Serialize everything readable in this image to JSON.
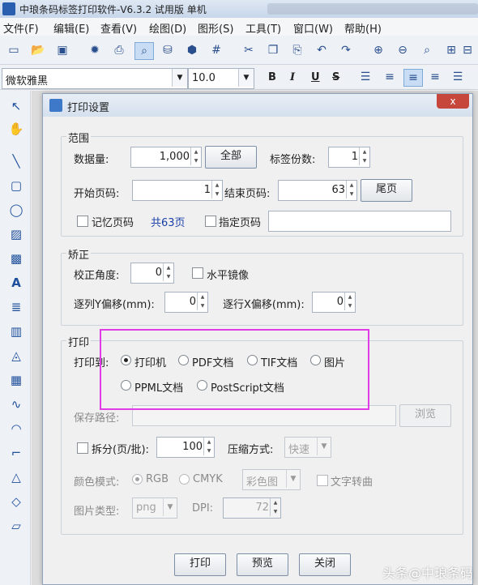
{
  "app": {
    "title": "中琅条码标签打印软件-V6.3.2 试用版 单机"
  },
  "menu": [
    "文件(F)",
    "编辑(E)",
    "查看(V)",
    "绘图(D)",
    "图形(S)",
    "工具(T)",
    "窗口(W)",
    "帮助(H)"
  ],
  "fontbar": {
    "font": "微软雅黑",
    "size": "10.0",
    "bold": "B",
    "italic": "I",
    "underline": "U",
    "strike": "S"
  },
  "dialog": {
    "title": "打印设置",
    "close": "x",
    "range": {
      "legend": "范围",
      "data_qty_label": "数据量:",
      "data_qty": "1,000",
      "all_button": "全部",
      "copies_label": "标签份数:",
      "copies": "1",
      "start_page_label": "开始页码:",
      "start_page": "1",
      "end_page_label": "结束页码:",
      "end_page": "63",
      "last_page_button": "尾页",
      "remember_page_label": "记忆页码",
      "total_pages": "共63页",
      "specify_page_label": "指定页码",
      "specify_page_value": ""
    },
    "correction": {
      "legend": "矫正",
      "angle_label": "校正角度:",
      "angle": "0",
      "mirror_label": "水平镜像",
      "col_offset_label": "逐列Y偏移(mm):",
      "col_offset": "0",
      "row_offset_label": "逐行X偏移(mm):",
      "row_offset": "0"
    },
    "print": {
      "legend": "打印",
      "print_to_label": "打印到:",
      "options": [
        "打印机",
        "PDF文档",
        "TIF文档",
        "图片",
        "PPML文档",
        "PostScript文档"
      ],
      "selected": "打印机",
      "save_path_label": "保存路径:",
      "save_path": "",
      "browse_button": "浏览",
      "split_label": "拆分(页/批):",
      "split_value": "100",
      "compress_label": "压缩方式:",
      "compress_value": "快速",
      "color_mode_label": "颜色模式:",
      "color_rgb": "RGB",
      "color_cmyk": "CMYK",
      "color_select": "彩色图",
      "text_to_curve_label": "文字转曲",
      "image_type_label": "图片类型:",
      "image_type": "png",
      "dpi_label": "DPI:",
      "dpi": "72"
    },
    "buttons": {
      "print": "打印",
      "preview": "预览",
      "close": "关闭"
    }
  },
  "watermark": "头条@中琅条码"
}
